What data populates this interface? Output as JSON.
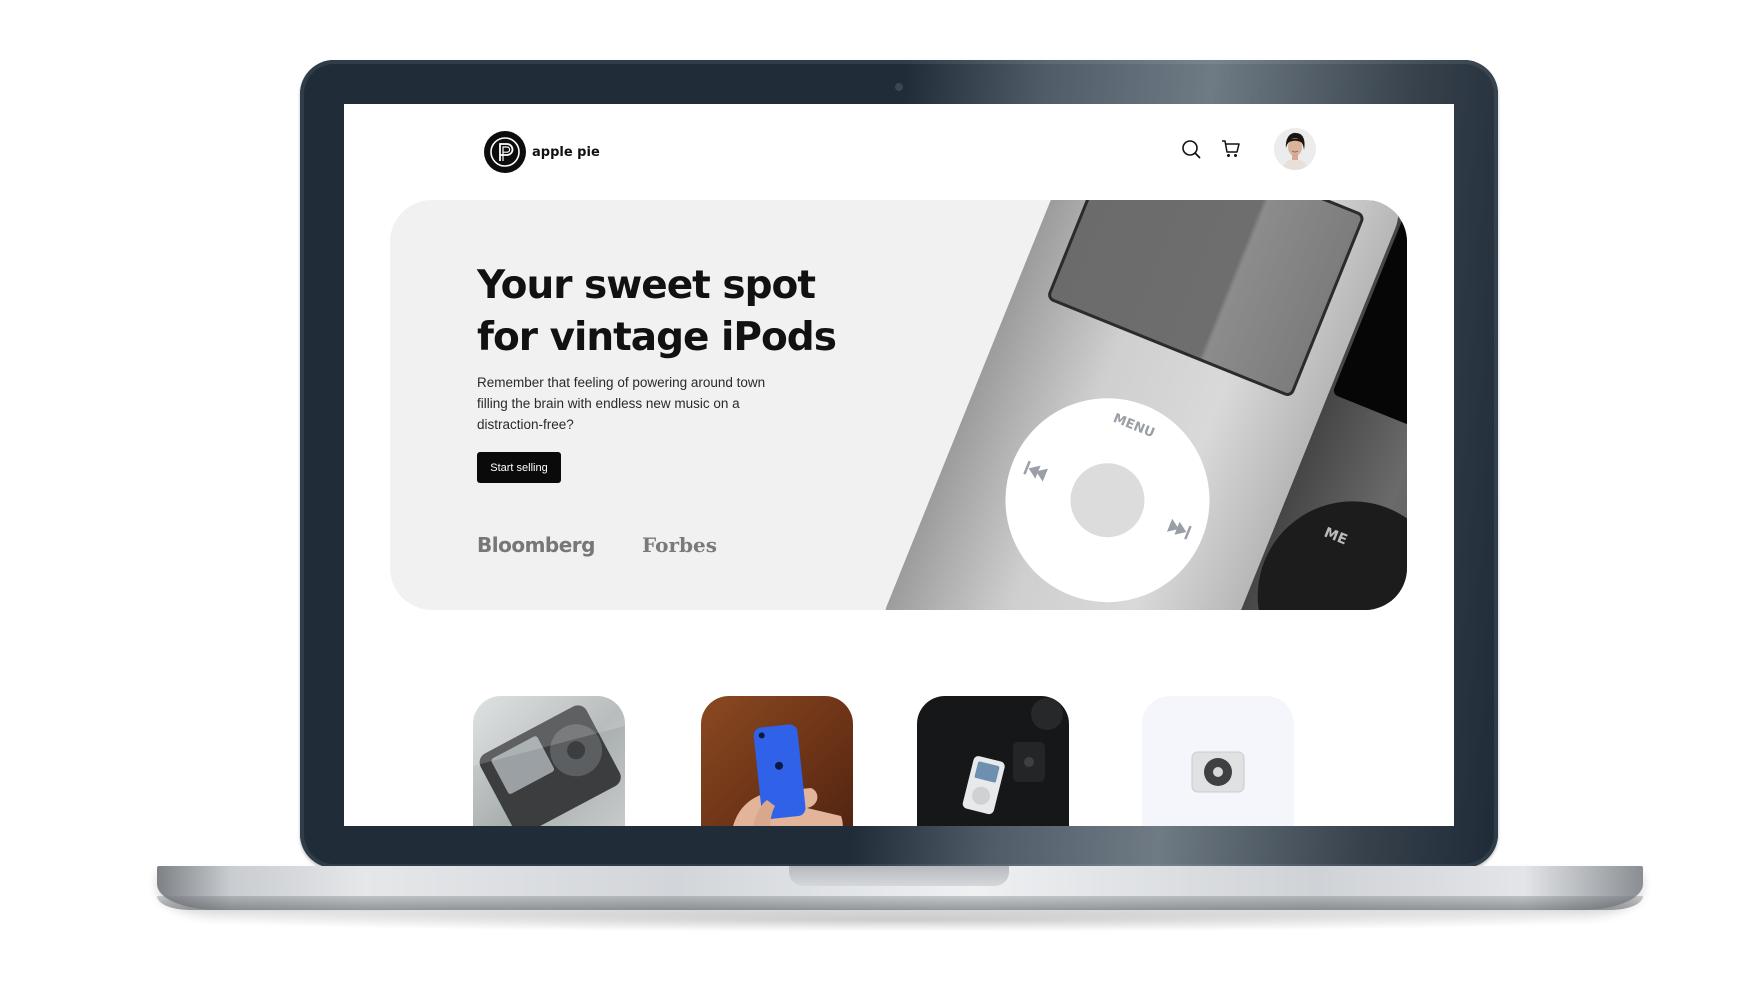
{
  "site": {
    "brand_name": "apple pie",
    "logo_letter": "P"
  },
  "header": {
    "icons": [
      "search-icon",
      "cart-icon"
    ],
    "avatar": "user-avatar"
  },
  "hero": {
    "title_line1": "Your sweet spot",
    "title_line2": "for vintage iPods",
    "description": "Remember that feeling of powering around town filling the brain with endless new music on a distraction-free?",
    "cta_label": "Start selling",
    "press": [
      "Bloomberg",
      "Forbes"
    ],
    "ipod_wheel_menu": "MENU",
    "ipod_wheel_menu_partial": "ME"
  },
  "products": [
    {
      "name": "black-ipod-classic"
    },
    {
      "name": "blue-ipod-touch"
    },
    {
      "name": "ipod-classic-on-black"
    },
    {
      "name": "ipod-shuffle"
    }
  ],
  "colors": {
    "laptop_bezel": "#202c38",
    "hero_bg": "#f1f1f1",
    "cta_bg": "#0a0a0a",
    "text": "#111111"
  }
}
